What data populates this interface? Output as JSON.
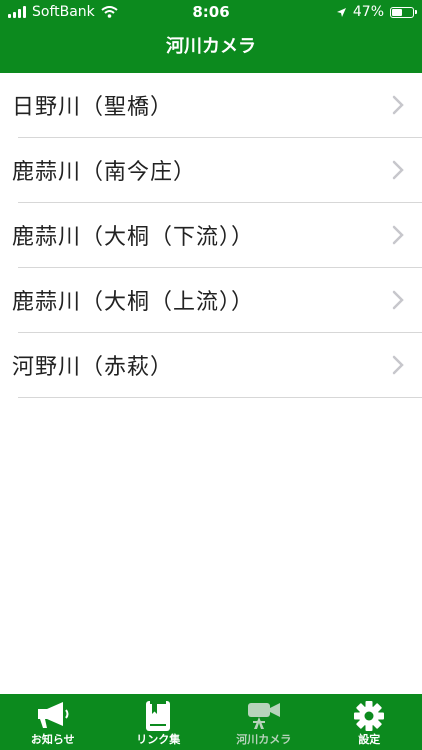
{
  "status": {
    "carrier": "SoftBank",
    "time": "8:06",
    "battery": "47%",
    "battery_level": 0.47
  },
  "header": {
    "title": "河川カメラ"
  },
  "list": {
    "items": [
      {
        "label": "日野川（聖橋）"
      },
      {
        "label": "鹿蒜川（南今庄）"
      },
      {
        "label": "鹿蒜川（大桐（下流））"
      },
      {
        "label": "鹿蒜川（大桐（上流））"
      },
      {
        "label": "河野川（赤萩）"
      }
    ]
  },
  "tabbar": {
    "tabs": [
      {
        "label": "お知らせ",
        "icon": "megaphone-icon"
      },
      {
        "label": "リンク集",
        "icon": "book-icon"
      },
      {
        "label": "河川カメラ",
        "icon": "video-camera-icon",
        "active": true
      },
      {
        "label": "設定",
        "icon": "gear-icon"
      }
    ]
  },
  "colors": {
    "brand": "#0c8a1e",
    "chevron": "#c7c7cc",
    "divider": "#d7d7d7"
  }
}
